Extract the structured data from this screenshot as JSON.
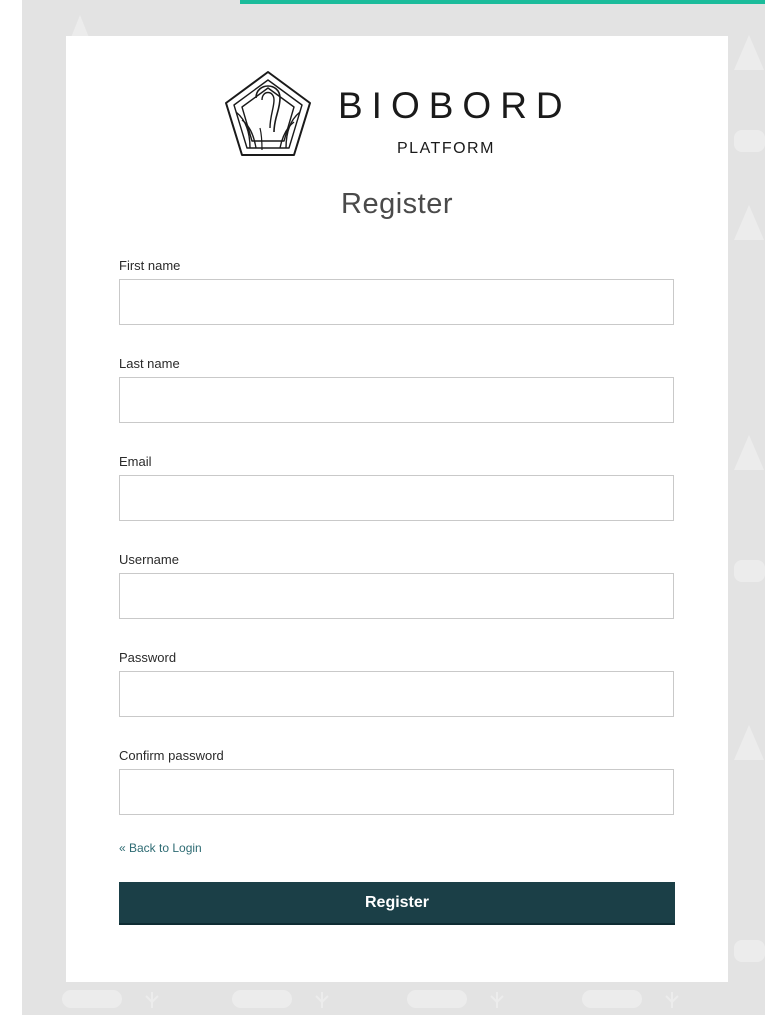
{
  "colors": {
    "accent_bar": "#1bbc9b",
    "button_bg": "#1b3f47",
    "link": "#2e6b73",
    "page_bg": "#e3e3e3"
  },
  "brand": {
    "logo_icon": "wood-grain-pentagon-icon",
    "name": "BIOBORD",
    "subtitle": "PLATFORM"
  },
  "form": {
    "title": "Register",
    "fields": [
      {
        "label": "First name",
        "value": ""
      },
      {
        "label": "Last name",
        "value": ""
      },
      {
        "label": "Email",
        "value": ""
      },
      {
        "label": "Username",
        "value": ""
      },
      {
        "label": "Password",
        "value": ""
      },
      {
        "label": "Confirm password",
        "value": ""
      }
    ],
    "back_link": "« Back to Login",
    "submit_label": "Register"
  }
}
